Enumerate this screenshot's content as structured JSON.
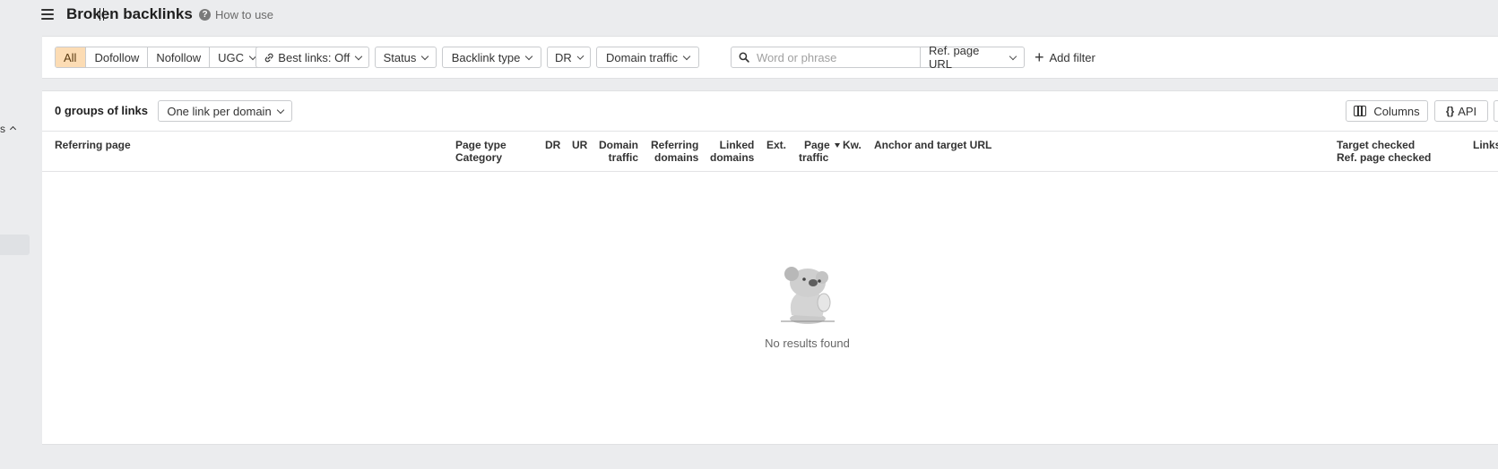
{
  "header": {
    "title": "Broken backlinks",
    "how_to_use": "How to use"
  },
  "sidebar": {
    "fragment_label": "s"
  },
  "filters": {
    "link_type_segments": [
      "All",
      "Dofollow",
      "Nofollow",
      "UGC"
    ],
    "active_segment": "All",
    "best_links": "Best links: Off",
    "status": "Status",
    "backlink_type": "Backlink type",
    "dr": "DR",
    "domain_traffic": "Domain traffic",
    "search_placeholder": "Word or phrase",
    "search_value": "",
    "search_mode": "Ref. page URL",
    "add_filter": "Add filter"
  },
  "results": {
    "groups_label": "0 groups of links",
    "grouping_select": "One link per domain",
    "columns_button": "Columns",
    "api_button": "API",
    "columns": {
      "referring_page": "Referring page",
      "page_type": "Page type",
      "category": "Category",
      "dr": "DR",
      "ur": "UR",
      "domain_traffic_1": "Domain",
      "domain_traffic_2": "traffic",
      "referring_domains_1": "Referring",
      "referring_domains_2": "domains",
      "linked_domains_1": "Linked",
      "linked_domains_2": "domains",
      "ext": "Ext.",
      "page_traffic_1": "Page",
      "page_traffic_2": "traffic",
      "kw": "Kw.",
      "anchor_target": "Anchor and target URL",
      "target_checked": "Target checked",
      "ref_page_checked": "Ref. page checked",
      "links": "Links"
    },
    "empty_message": "No results found"
  },
  "colors": {
    "active_segment_bg": "#fcdcb4",
    "page_bg": "#ebecee",
    "panel_bg": "#ffffff"
  }
}
